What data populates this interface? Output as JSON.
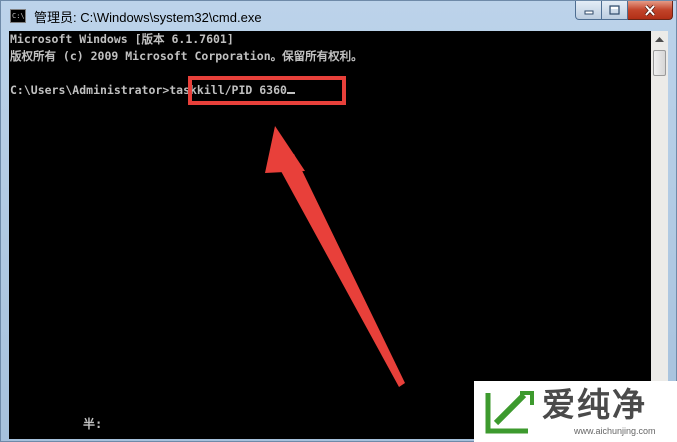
{
  "window": {
    "title": "管理员: C:\\Windows\\system32\\cmd.exe"
  },
  "icons": {
    "app": "cmd-icon",
    "minimize": "minimize-icon",
    "maximize": "maximize-icon",
    "close": "close-icon",
    "scroll_up": "arrow-up-icon",
    "scroll_down": "arrow-down-icon"
  },
  "console": {
    "lines": [
      "Microsoft Windows [版本 6.1.7601]",
      "版权所有 (c) 2009 Microsoft Corporation。保留所有权利。",
      "",
      "C:\\Users\\Administrator>taskkill/PID 6360"
    ],
    "ime_indicator": "半:"
  },
  "annotation": {
    "color": "#e8403a"
  },
  "watermark": {
    "name": "爱纯净",
    "url": "www.aichunjing.com",
    "accent": "#3d9a2e"
  }
}
